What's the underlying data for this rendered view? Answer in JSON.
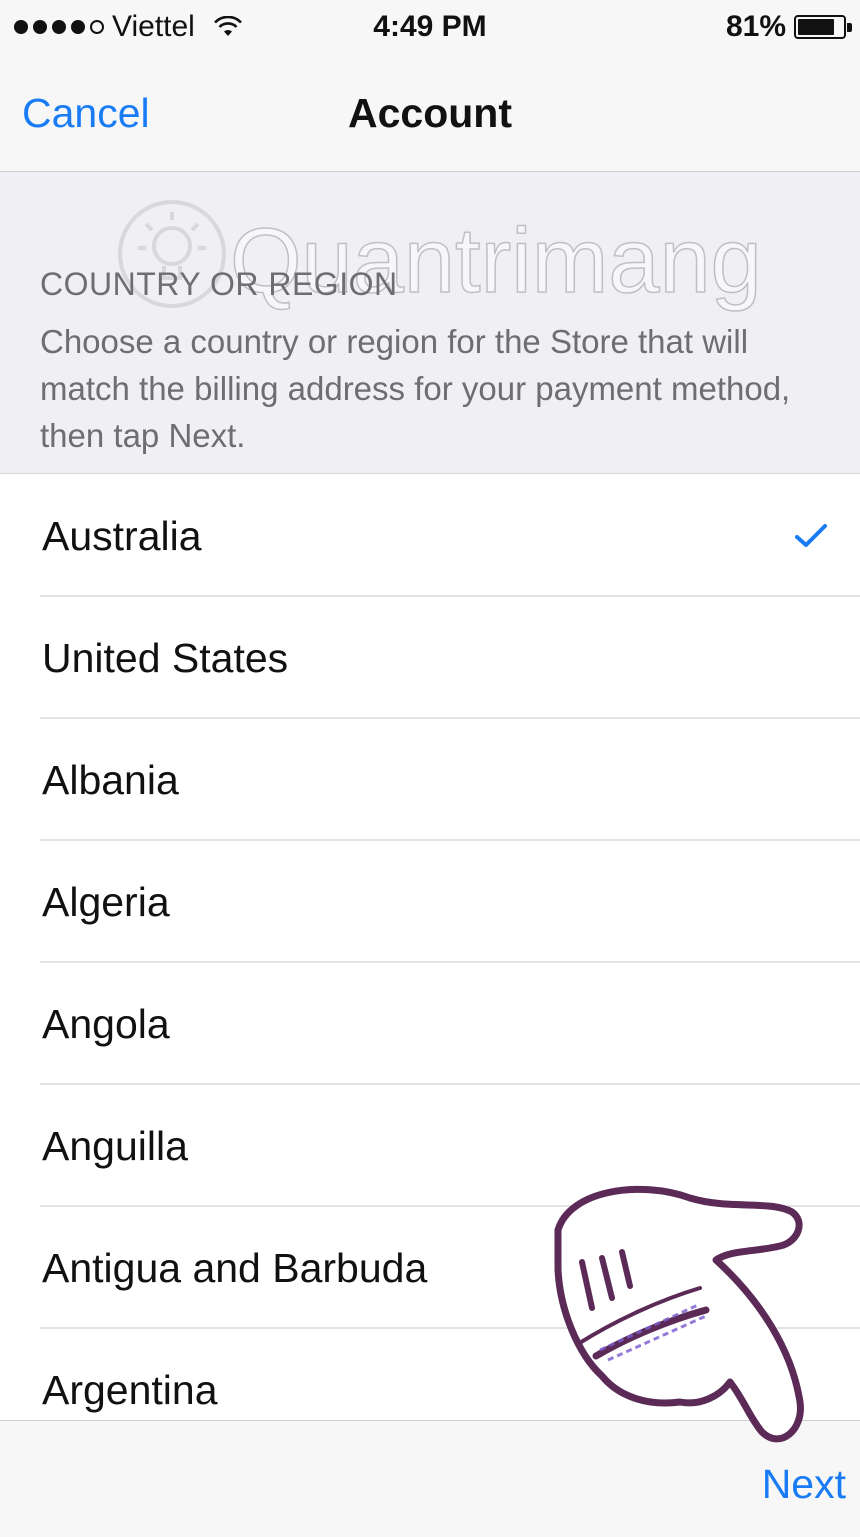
{
  "status_bar": {
    "carrier": "Viettel",
    "time": "4:49 PM",
    "battery_percent_label": "81%",
    "battery_level": 0.81,
    "signal_bars_filled": 4,
    "signal_bars_total": 5
  },
  "nav": {
    "cancel_label": "Cancel",
    "title": "Account"
  },
  "watermark": "Quantrimang",
  "section": {
    "title": "COUNTRY OR REGION",
    "description": "Choose a country or region for the Store that will match the billing address for your payment method, then tap Next."
  },
  "countries": [
    {
      "name": "Australia",
      "selected": true
    },
    {
      "name": "United States",
      "selected": false
    },
    {
      "name": "Albania",
      "selected": false
    },
    {
      "name": "Algeria",
      "selected": false
    },
    {
      "name": "Angola",
      "selected": false
    },
    {
      "name": "Anguilla",
      "selected": false
    },
    {
      "name": "Antigua and Barbuda",
      "selected": false
    },
    {
      "name": "Argentina",
      "selected": false
    }
  ],
  "toolbar": {
    "next_label": "Next"
  },
  "icons": {
    "checkmark": "checkmark-icon",
    "wifi": "wifi-icon",
    "battery": "battery-icon",
    "pointer": "pointing-hand-icon"
  },
  "colors": {
    "accent": "#1a7cf5",
    "header_background": "#efeff4",
    "bar_background": "#f7f7f7",
    "secondary_text": "#6d6d72",
    "hand_outline": "#5b2a57"
  }
}
